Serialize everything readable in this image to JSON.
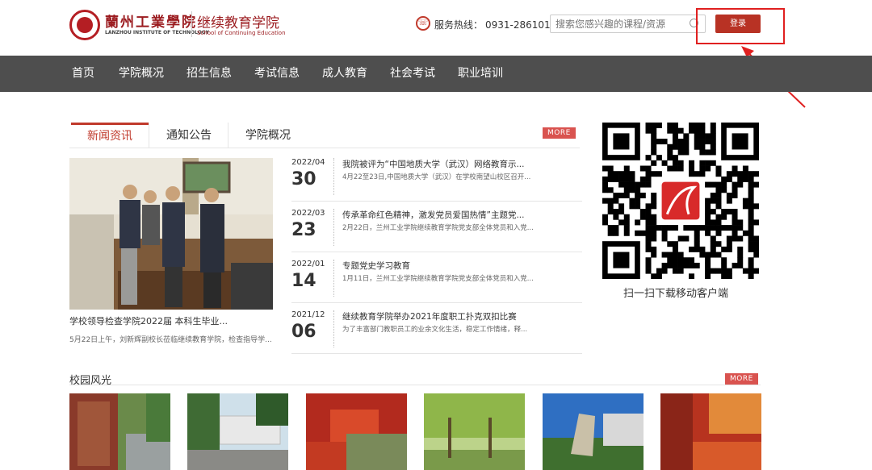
{
  "header": {
    "school_cn": "蘭州工業學院",
    "school_en": "LANZHOU INSTITUTE OF TECHNOLOGY",
    "dept_cn": "继续教育学院",
    "dept_en": "School of Continuing Education",
    "hotline_label": "服务热线：",
    "hotline_number": "0931-2861012",
    "search_placeholder": "搜索您感兴趣的课程/资源",
    "login_label": "登录"
  },
  "nav": [
    "首页",
    "学院概况",
    "招生信息",
    "考试信息",
    "成人教育",
    "社会考试",
    "职业培训"
  ],
  "tabs": [
    "新闻资讯",
    "通知公告",
    "学院概况"
  ],
  "more_label": "MORE",
  "featured": {
    "title": "学校领导检查学院2022届 本科生毕业...",
    "desc": "5月22日上午，刘新辉副校长莅临继续教育学院，检查指导学..."
  },
  "news": [
    {
      "ym": "2022/04",
      "day": "30",
      "title": "我院被评为“中国地质大学（武汉）网络教育示...",
      "desc": "4月22至23日,中国地质大学（武汉）在学校南望山校区召开..."
    },
    {
      "ym": "2022/03",
      "day": "23",
      "title": "传承革命红色精神，激发党员爱国热情”主题党...",
      "desc": "2月22日，兰州工业学院继续教育学院党支部全体党员和入党..."
    },
    {
      "ym": "2022/01",
      "day": "14",
      "title": "专题党史学习教育",
      "desc": "1月11日，兰州工业学院继续教育学院党支部全体党员和入党..."
    },
    {
      "ym": "2021/12",
      "day": "06",
      "title": "继续教育学院举办2021年度职工扑克双扣比赛",
      "desc": "为了丰富部门教职员工的业余文化生活，稳定工作情绪，释..."
    }
  ],
  "qr_label": "扫一扫下载移动客户端",
  "campus": {
    "title": "校园风光"
  },
  "colors": {
    "brand": "#b83224",
    "nav_bg": "#4e4e4e",
    "more_bg": "#d9534f"
  }
}
